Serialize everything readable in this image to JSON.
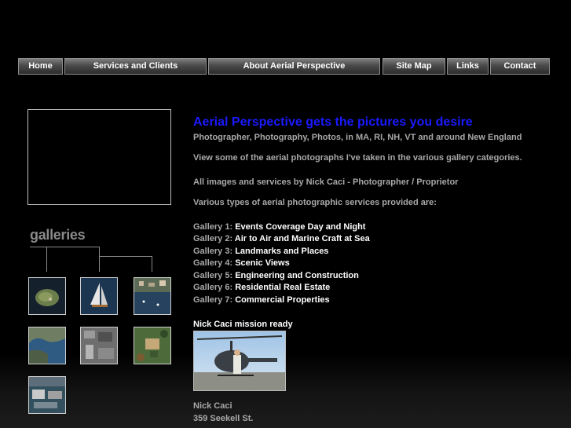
{
  "nav": [
    {
      "label": "Home"
    },
    {
      "label": "Services and Clients"
    },
    {
      "label": "About Aerial Perspective"
    },
    {
      "label": "Site Map"
    },
    {
      "label": "Links"
    },
    {
      "label": "Contact"
    }
  ],
  "left": {
    "galleries_title": "galleries"
  },
  "main": {
    "headline": "Aerial Perspective gets the pictures you desire",
    "subline": "Photographer, Photography, Photos, in MA, RI, NH, VT and around New England",
    "intro": "View some of the aerial photographs I've taken in the various gallery categories.",
    "credit": "All images and services by Nick Caci - Photographer / Proprietor",
    "services_intro": "Various types of aerial photographic services provided are:",
    "galleries": [
      {
        "prefix": "Gallery 1:",
        "name": "Events Coverage Day and Night"
      },
      {
        "prefix": "Gallery 2:",
        "name": "Air to Air and Marine Craft at Sea"
      },
      {
        "prefix": "Gallery 3:",
        "name": "Landmarks and Places"
      },
      {
        "prefix": "Gallery 4:",
        "name": "Scenic Views"
      },
      {
        "prefix": "Gallery 5:",
        "name": "Engineering and Construction"
      },
      {
        "prefix": "Gallery 6:",
        "name": "Residential Real Estate"
      },
      {
        "prefix": "Gallery 7:",
        "name": "Commercial Properties"
      }
    ],
    "mission": "Nick Caci mission ready",
    "address": {
      "name": "Nick Caci",
      "street": "359 Seekell St."
    }
  }
}
